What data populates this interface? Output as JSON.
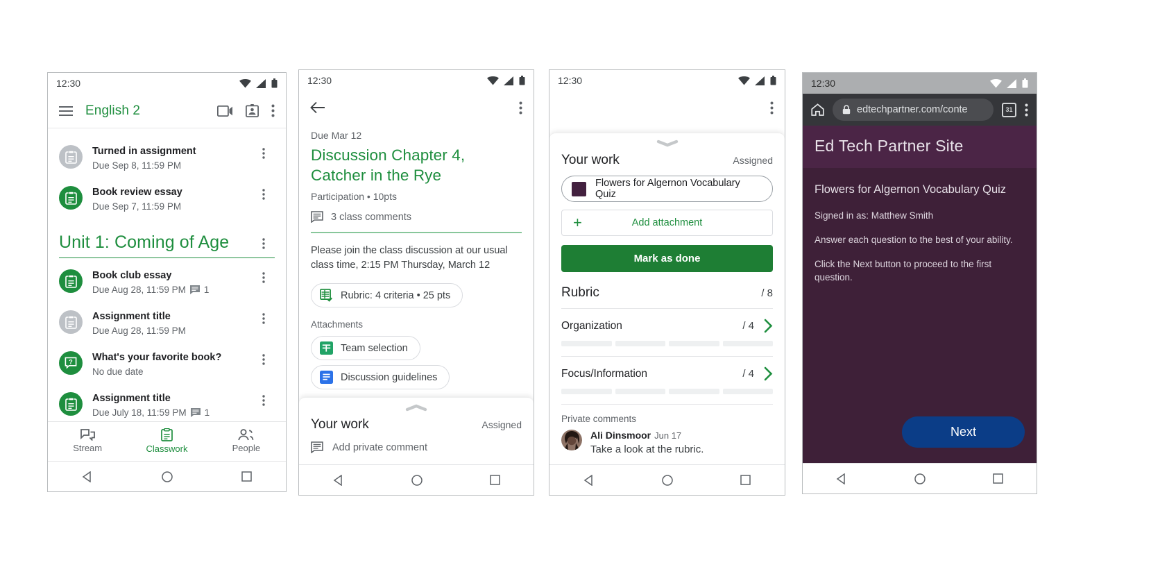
{
  "status_bar": {
    "time": "12:30"
  },
  "screen1": {
    "app_title": "English 2",
    "icons": {
      "menu": "hamburger-menu-icon",
      "video": "video-call-icon",
      "badge": "class-card-icon",
      "overflow": "overflow-menu-icon"
    },
    "top_items": [
      {
        "title": "Turned in assignment",
        "subtitle": "Due Sep 8, 11:59 PM",
        "icon": "assignment-icon",
        "state": "grey",
        "comment_count": ""
      },
      {
        "title": "Book review essay",
        "subtitle": "Due Sep 7, 11:59 PM",
        "icon": "assignment-icon",
        "state": "green",
        "comment_count": ""
      }
    ],
    "unit_title": "Unit 1: Coming of Age",
    "unit_items": [
      {
        "title": "Book club essay",
        "subtitle": "Due Aug 28, 11:59 PM",
        "icon": "assignment-icon",
        "state": "green",
        "comment_count": "1"
      },
      {
        "title": "Assignment title",
        "subtitle": "Due Aug 28, 11:59 PM",
        "icon": "assignment-icon",
        "state": "grey",
        "comment_count": ""
      },
      {
        "title": "What's your favorite book?",
        "subtitle": "No due date",
        "icon": "question-icon",
        "state": "green",
        "comment_count": ""
      },
      {
        "title": "Assignment title",
        "subtitle": "Due July 18, 11:59 PM",
        "icon": "assignment-icon",
        "state": "green",
        "comment_count": "1"
      }
    ],
    "tabs": [
      {
        "label": "Stream",
        "icon": "stream-icon",
        "active": false
      },
      {
        "label": "Classwork",
        "icon": "classwork-icon",
        "active": true
      },
      {
        "label": "People",
        "icon": "people-icon",
        "active": false
      }
    ]
  },
  "screen2": {
    "back_icon": "back-arrow-icon",
    "overflow_icon": "overflow-menu-icon",
    "due": "Due Mar 12",
    "title": "Discussion Chapter 4, Catcher in the Rye",
    "meta": "Participation • 10pts",
    "class_comments": "3 class comments",
    "description": "Please join the class discussion at our usual class time, 2:15 PM Thursday, March 12",
    "rubric_chip": "Rubric: 4 criteria • 25 pts",
    "attachments_label": "Attachments",
    "attachments": [
      {
        "label": "Team selection",
        "icon": "google-sheets-icon"
      },
      {
        "label": "Discussion guidelines",
        "icon": "google-docs-icon"
      }
    ],
    "your_work": {
      "title": "Your work",
      "status": "Assigned",
      "add_comment": "Add private comment"
    }
  },
  "screen3": {
    "overflow_icon": "overflow-menu-icon",
    "your_work": {
      "title": "Your work",
      "status": "Assigned"
    },
    "attachment": {
      "label": "Flowers for Algernon Vocabulary Quiz",
      "color": "#43213f"
    },
    "add_attachment": "Add attachment",
    "mark_done": "Mark as done",
    "rubric": {
      "title": "Rubric",
      "total": "/ 8",
      "criteria": [
        {
          "name": "Organization",
          "score": "/ 4",
          "levels": 4
        },
        {
          "name": "Focus/Information",
          "score": "/ 4",
          "levels": 4
        }
      ]
    },
    "private_comments": {
      "label": "Private comments",
      "items": [
        {
          "author": "Ali Dinsmoor",
          "date": "Jun 17",
          "text": "Take a look at the rubric."
        }
      ]
    }
  },
  "screen4": {
    "browser": {
      "home_icon": "home-icon",
      "lock_icon": "lock-icon",
      "url": "edtechpartner.com/conte",
      "tab_count": "31",
      "overflow_icon": "overflow-menu-icon"
    },
    "site_title": "Ed Tech Partner Site",
    "page_title": "Flowers for Algernon Vocabulary Quiz",
    "lines": [
      "Signed in as: Matthew Smith",
      "Answer each question to the best of your ability.",
      "Click the Next button to proceed to the first question."
    ],
    "next_button": "Next",
    "colors": {
      "header": "#4b2546",
      "body": "#3e2038",
      "button": "#0b3d87"
    }
  },
  "android_nav": {
    "back": "back-triangle-icon",
    "home": "home-circle-icon",
    "recents": "recents-square-icon"
  }
}
